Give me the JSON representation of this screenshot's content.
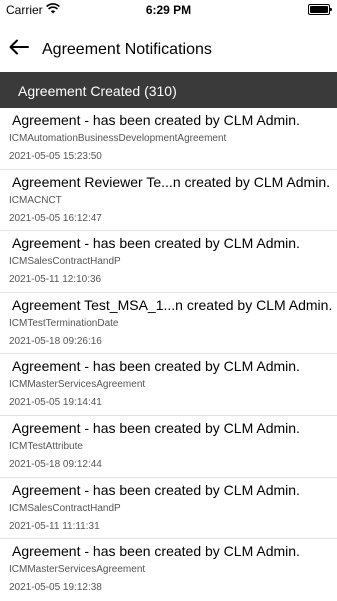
{
  "status_bar": {
    "carrier": "Carrier",
    "time": "6:29 PM"
  },
  "nav": {
    "title": "Agreement Notifications"
  },
  "section": {
    "header": "Agreement Created (310)"
  },
  "items": [
    {
      "title": "Agreement - has been created by CLM Admin.",
      "subtitle": "ICMAutomationBusinessDevelopmentAgreement",
      "date": "2021-05-05 15:23:50"
    },
    {
      "title": "Agreement Reviewer Te...n created by CLM Admin.",
      "subtitle": "ICMACNCT",
      "date": "2021-05-05 16:12:47"
    },
    {
      "title": "Agreement - has been created by CLM Admin.",
      "subtitle": "ICMSalesContractHandP",
      "date": "2021-05-11 12:10:36"
    },
    {
      "title": "Agreement Test_MSA_1...n created by CLM Admin.",
      "subtitle": "ICMTestTerminationDate",
      "date": "2021-05-18 09:26:16"
    },
    {
      "title": "Agreement - has been created by CLM Admin.",
      "subtitle": "ICMMasterServicesAgreement",
      "date": "2021-05-05 19:14:41"
    },
    {
      "title": "Agreement - has been created by CLM Admin.",
      "subtitle": "ICMTestAttribute",
      "date": "2021-05-18 09:12:44"
    },
    {
      "title": "Agreement - has been created by CLM Admin.",
      "subtitle": "ICMSalesContractHandP",
      "date": "2021-05-11 11:11:31"
    },
    {
      "title": "Agreement - has been created by CLM Admin.",
      "subtitle": "ICMMasterServicesAgreement",
      "date": "2021-05-05 19:12:38"
    }
  ]
}
